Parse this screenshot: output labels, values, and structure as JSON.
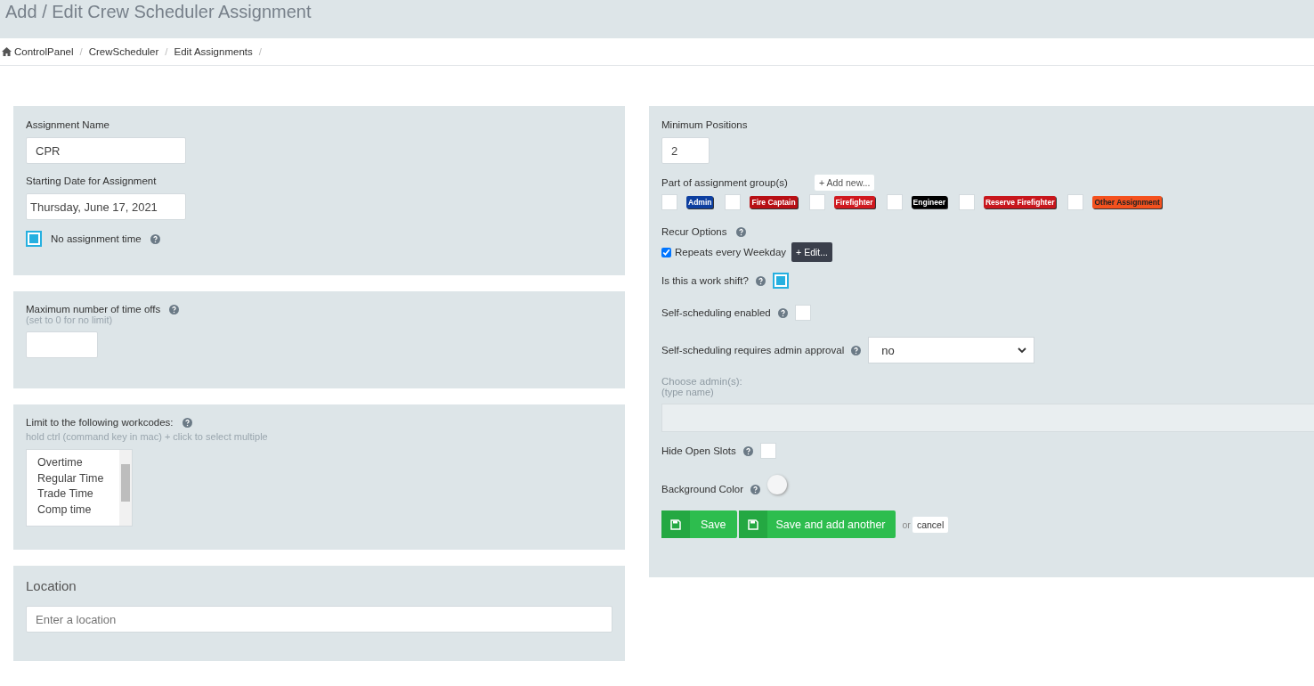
{
  "page_title": "Add / Edit Crew Scheduler Assignment",
  "breadcrumb": [
    {
      "label": "ControlPanel"
    },
    {
      "label": "CrewScheduler"
    },
    {
      "label": "Edit Assignments"
    }
  ],
  "breadcrumb_separator": "/",
  "assignment_name": {
    "label": "Assignment Name",
    "value": "CPR"
  },
  "starting_date": {
    "label": "Starting Date for Assignment",
    "value": "Thursday, June 17, 2021"
  },
  "no_assignment_time": {
    "label": "No assignment time",
    "checked": true
  },
  "max_time_offs": {
    "label": "Maximum number of time offs",
    "hint": "(set to 0 for no limit)"
  },
  "workcodes": {
    "label": "Limit to the following workcodes:",
    "hint": "hold ctrl (command key in mac) + click to select multiple",
    "options": [
      "Overtime",
      "Regular Time",
      "Trade Time",
      "Comp time"
    ]
  },
  "location": {
    "title": "Location",
    "placeholder": "Enter a location"
  },
  "minimum_positions": {
    "label": "Minimum Positions",
    "value": "2"
  },
  "groups": {
    "label": "Part of assignment group(s)",
    "add_button": "+ Add new...",
    "items": [
      {
        "name": "Admin",
        "color": "#0d3fa0",
        "checked": false
      },
      {
        "name": "Fire Captain",
        "color": "#b80f14",
        "checked": false
      },
      {
        "name": "Firefighter",
        "color": "#d0191f",
        "checked": false
      },
      {
        "name": "Engineer",
        "color": "#000000",
        "checked": false
      },
      {
        "name": "Reserve Firefighter",
        "color": "#c8161c",
        "checked": false
      },
      {
        "name": "Other Assignment",
        "color": "#f4511e",
        "checked": false
      }
    ]
  },
  "recur": {
    "label": "Recur Options",
    "option": "Repeats every Weekday",
    "checked": true,
    "edit_button": "+ Edit..."
  },
  "work_shift": {
    "label": "Is this a work shift?",
    "checked": true
  },
  "self_scheduling": {
    "label": "Self-scheduling enabled",
    "checked": false
  },
  "admin_approval": {
    "label": "Self-scheduling requires admin approval",
    "value": "no"
  },
  "choose_admins": {
    "label": "Choose admin(s):",
    "hint": "(type name)"
  },
  "hide_open_slots": {
    "label": "Hide Open Slots",
    "checked": false
  },
  "background_color": {
    "label": "Background Color"
  },
  "actions": {
    "save": "Save",
    "save_another": "Save and add another",
    "or": "or",
    "cancel": "cancel"
  }
}
